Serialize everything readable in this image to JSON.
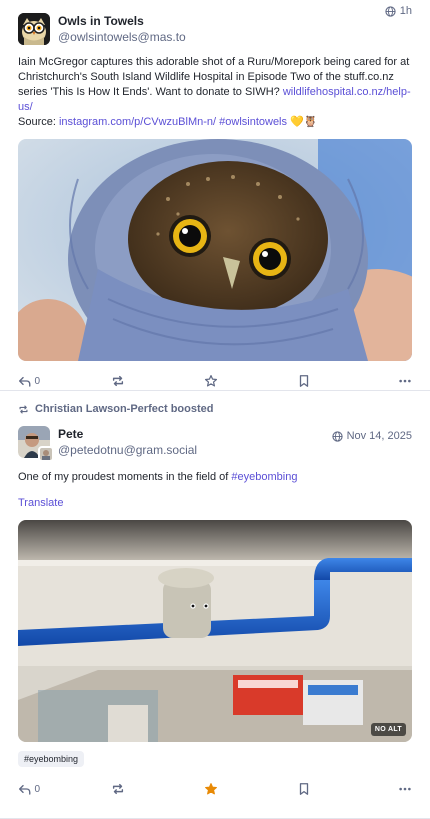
{
  "posts": [
    {
      "author_name": "Owls in Towels",
      "author_handle": "@owlsintowels@mas.to",
      "time": "1h",
      "content": {
        "text1": "Iain McGregor captures this adorable shot of a Ruru/Morepork being cared for at Christchurch's South Island Wildlife Hospital in Episode Two of the stuff.co.nz series 'This Is How It Ends'. Want to donate to SIWH? ",
        "link1": "wildlifehospital.co.nz/help-us/",
        "text2": "Source: ",
        "link2": "instagram.com/p/CVwzuBlMn-n/",
        "hashtag": "#owlsintowels",
        "emoji": "💛🦉"
      },
      "replies": "0",
      "media_alt_badge": ""
    },
    {
      "boosted_by": "Christian Lawson-Perfect boosted",
      "author_name": "Pete",
      "author_handle": "@petedotnu@gram.social",
      "time": "Nov 14, 2025",
      "content": {
        "text1": "One of my proudest moments in the field of ",
        "hashtag": "#eyebombing"
      },
      "translate": "Translate",
      "no_alt": "NO ALT",
      "tag_chip": "#eyebombing",
      "replies": "0",
      "favourited": true
    }
  ],
  "colors": {
    "accent": "#5b4fd6",
    "muted": "#606984",
    "favourite": "#e88a06",
    "bus_bar": "#1f63c9"
  },
  "icons": [
    "globe-icon",
    "reply-icon",
    "boost-icon",
    "star-icon",
    "bookmark-icon",
    "more-icon",
    "owl-avatar",
    "user-avatar"
  ]
}
